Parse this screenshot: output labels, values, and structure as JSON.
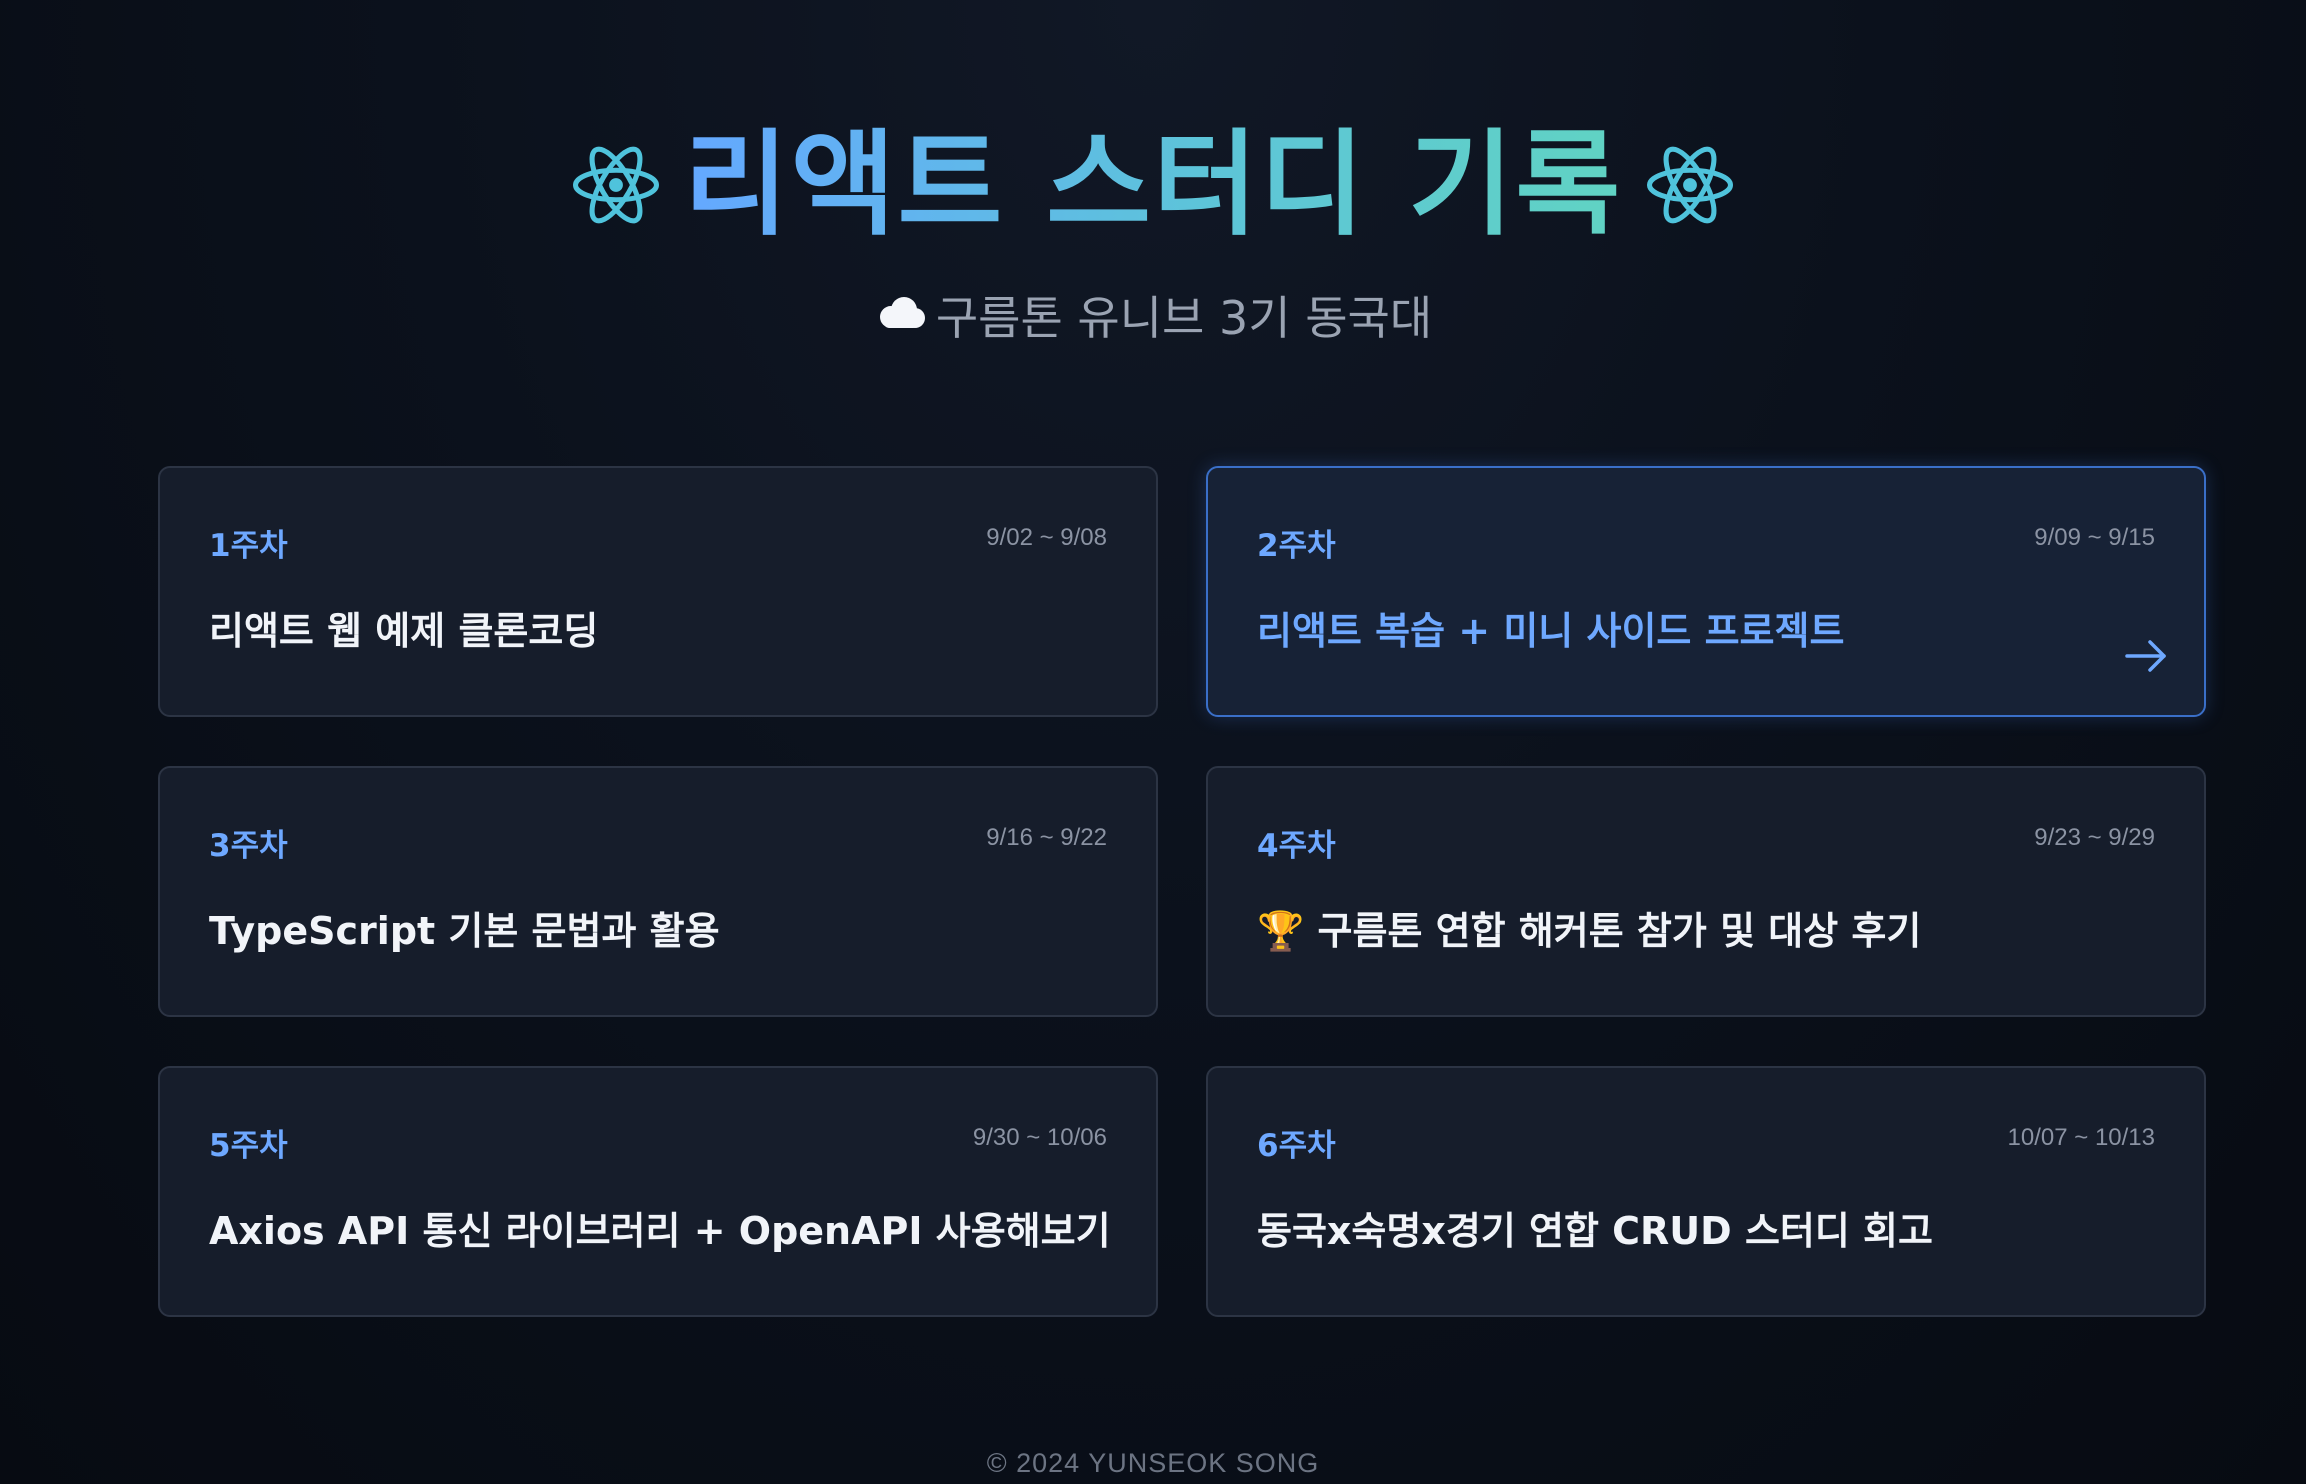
{
  "header": {
    "title": "리액트 스터디 기록",
    "left_icon": "react-logo-icon",
    "right_icon": "react-logo-icon",
    "subtitle_icon": "cloud-icon",
    "subtitle": "구름톤 유니브 3기 동국대"
  },
  "cards": [
    {
      "week": "1주차",
      "date": "9/02 ~ 9/08",
      "title": "리액트 웹 예제 클론코딩",
      "active": false
    },
    {
      "week": "2주차",
      "date": "9/09 ~ 9/15",
      "title": "리액트 복습 + 미니 사이드 프로젝트",
      "active": true,
      "icon": "arrow-right-icon"
    },
    {
      "week": "3주차",
      "date": "9/16 ~ 9/22",
      "title": "TypeScript 기본 문법과 활용",
      "active": false
    },
    {
      "week": "4주차",
      "date": "9/23 ~ 9/29",
      "title": "🏆 구름톤 연합 해커톤 참가 및 대상 후기",
      "active": false
    },
    {
      "week": "5주차",
      "date": "9/30 ~ 10/06",
      "title": "Axios API 통신 라이브러리 + OpenAPI 사용해보기",
      "active": false
    },
    {
      "week": "6주차",
      "date": "10/07 ~ 10/13",
      "title": "동국x숙명x경기 연합 CRUD 스터디 회고",
      "active": false
    }
  ],
  "colors": {
    "accent": "#6ea8ff",
    "title_gradient_start": "#64a8ff",
    "title_gradient_end": "#60d3c3",
    "card_bg": "#161d2b",
    "card_border": "#2c3444",
    "active_border": "#3a6fc8"
  },
  "footer": {
    "text": "© 2024 YUNSEOK SONG"
  }
}
